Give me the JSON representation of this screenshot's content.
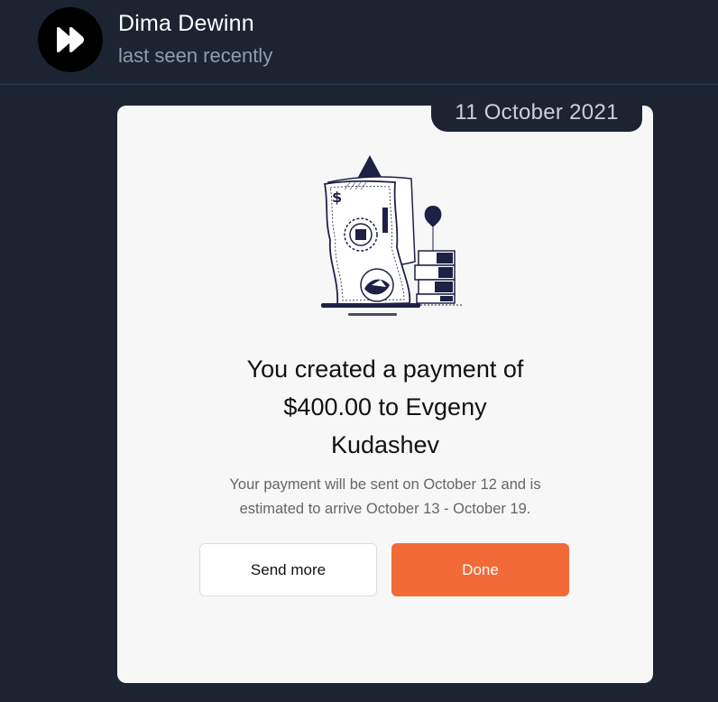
{
  "chat": {
    "contact_name": "Dima Dewinn",
    "contact_status": "last seen recently",
    "avatar_icon": "fast-forward-icon"
  },
  "message": {
    "date": "11 October 2021",
    "illustration_icon": "dollar-bill-growth-illustration",
    "headline_lines": [
      "You created a payment of",
      "$400.00 to Evgeny",
      "Kudashev"
    ],
    "subtext_lines": [
      "Your payment will be sent on October 12 and is",
      "estimated to arrive October 13 - October 19."
    ],
    "send_more_label": "Send more",
    "done_label": "Done",
    "accent_color": "#f26a38"
  }
}
